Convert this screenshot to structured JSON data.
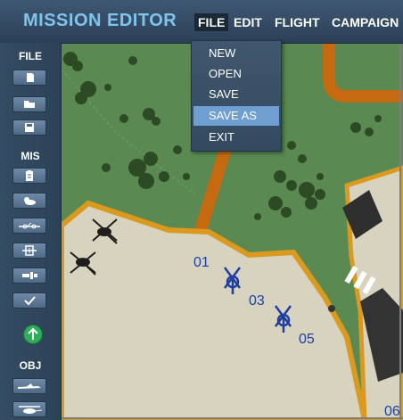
{
  "header": {
    "title": "MISSION EDITOR",
    "menu": [
      {
        "label": "FILE",
        "active": true
      },
      {
        "label": "EDIT"
      },
      {
        "label": "FLIGHT"
      },
      {
        "label": "CAMPAIGN"
      }
    ]
  },
  "file_menu": {
    "items": [
      {
        "label": "NEW"
      },
      {
        "label": "OPEN"
      },
      {
        "label": "SAVE"
      },
      {
        "label": "SAVE AS",
        "highlighted": true
      },
      {
        "label": "EXIT"
      }
    ]
  },
  "sidebar": {
    "file_label": "FILE",
    "mis_label": "MIS",
    "obj_label": "OBJ",
    "file_tools": [
      "new-file-icon",
      "open-folder-icon",
      "save-disk-icon"
    ],
    "mis_tools": [
      "clipboard-icon",
      "weather-icon",
      "route-icon",
      "target-icon",
      "runway-icon",
      "checkmark-icon"
    ],
    "go_icon": "up-arrow-icon",
    "obj_tools": [
      "aircraft-icon",
      "helicopter-icon"
    ]
  },
  "map": {
    "pad_labels": [
      "01",
      "03",
      "05",
      "06"
    ]
  },
  "colors": {
    "title": "#7fc4ec",
    "grass": "#5a8a52",
    "apron": "#d8d3bf",
    "road": "#c66a12",
    "menu_highlight": "#6f9ed0",
    "pad_marker": "#1f3fa0"
  }
}
